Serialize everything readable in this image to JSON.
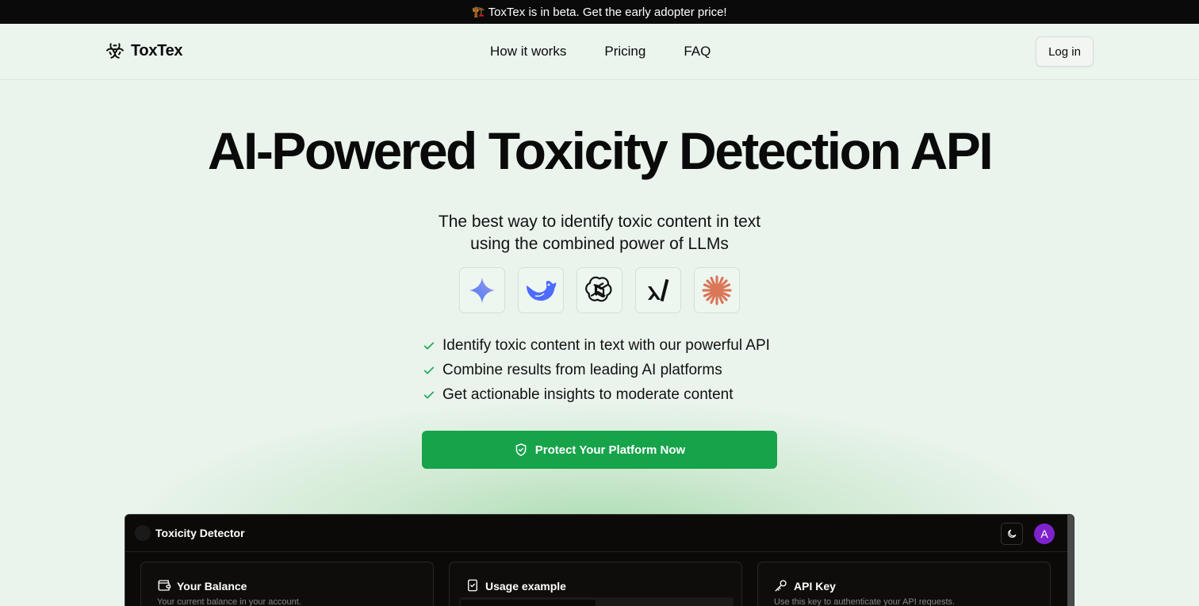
{
  "banner": {
    "emoji": "🏗️",
    "text": "ToxTex is in beta. Get the early adopter price!"
  },
  "nav": {
    "brand": "ToxTex",
    "links": [
      "How it works",
      "Pricing",
      "FAQ"
    ],
    "login_label": "Log in"
  },
  "hero": {
    "title": "AI-Powered Toxicity Detection API",
    "subtitle_line1": "The best way to identify toxic content in text",
    "subtitle_line2": "using the combined power of LLMs",
    "providers": [
      "gemini-icon",
      "deepseek-icon",
      "openai-icon",
      "xai-icon",
      "anthropic-icon"
    ],
    "features": [
      "Identify toxic content in text with our powerful API",
      "Combine results from leading AI platforms",
      "Get actionable insights to moderate content"
    ],
    "cta_label": "Protect Your Platform Now"
  },
  "app": {
    "title": "Toxicity Detector",
    "avatar_initial": "A",
    "cards": [
      {
        "title": "Your Balance",
        "desc": "Your current balance in your account."
      },
      {
        "title": "Usage example",
        "desc": ""
      },
      {
        "title": "API Key",
        "desc": "Use this key to authenticate your API requests."
      }
    ]
  },
  "colors": {
    "accent": "#16a34a",
    "background": "#eaf4ec",
    "banner": "#0a0a0a",
    "avatar": "#7e22ce"
  }
}
